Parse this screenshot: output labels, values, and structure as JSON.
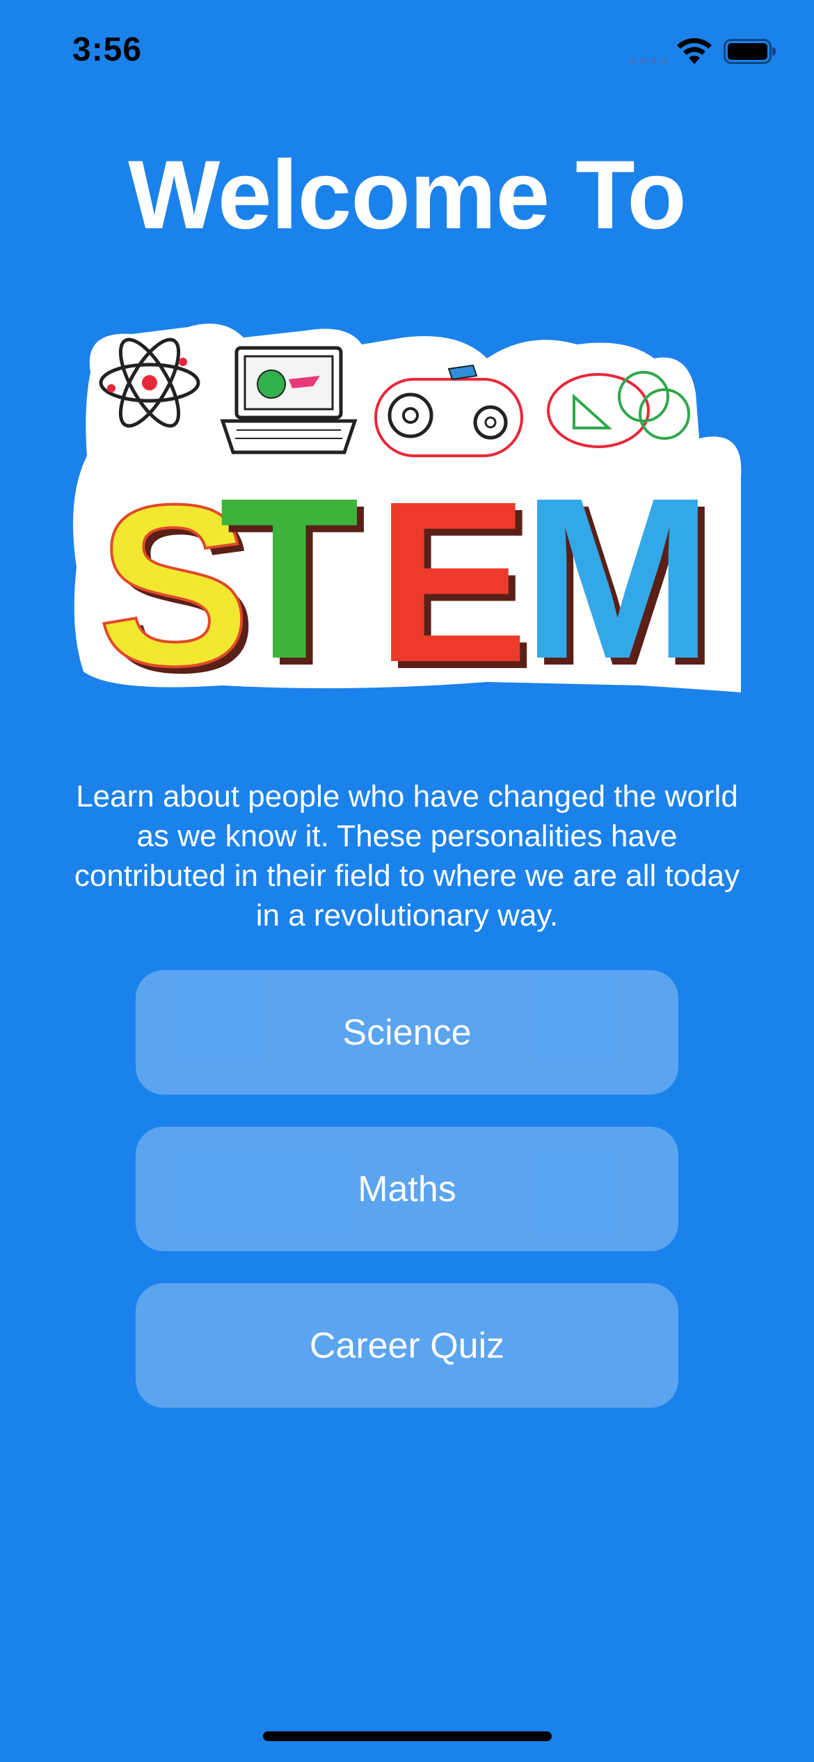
{
  "status_bar": {
    "time": "3:56"
  },
  "header": {
    "title": "Welcome To"
  },
  "logo": {
    "text": "STEM",
    "letter_colors": [
      "#f2e830",
      "#3cb43c",
      "#ee3a2a",
      "#33a8e8"
    ]
  },
  "description": "Learn about people who have changed the world as we know it. These personalities have contributed in their field to where we are all today in a revolutionary way.",
  "buttons": {
    "science": "Science",
    "maths": "Maths",
    "career_quiz": "Career Quiz"
  },
  "colors": {
    "background": "#1b82eb",
    "button_fill": "rgba(255,255,255,0.28)",
    "text": "#ffffff"
  },
  "icons": [
    "signal-icon",
    "wifi-icon",
    "battery-icon",
    "atom-icon",
    "laptop-icon",
    "gears-icon",
    "geometry-icon"
  ]
}
